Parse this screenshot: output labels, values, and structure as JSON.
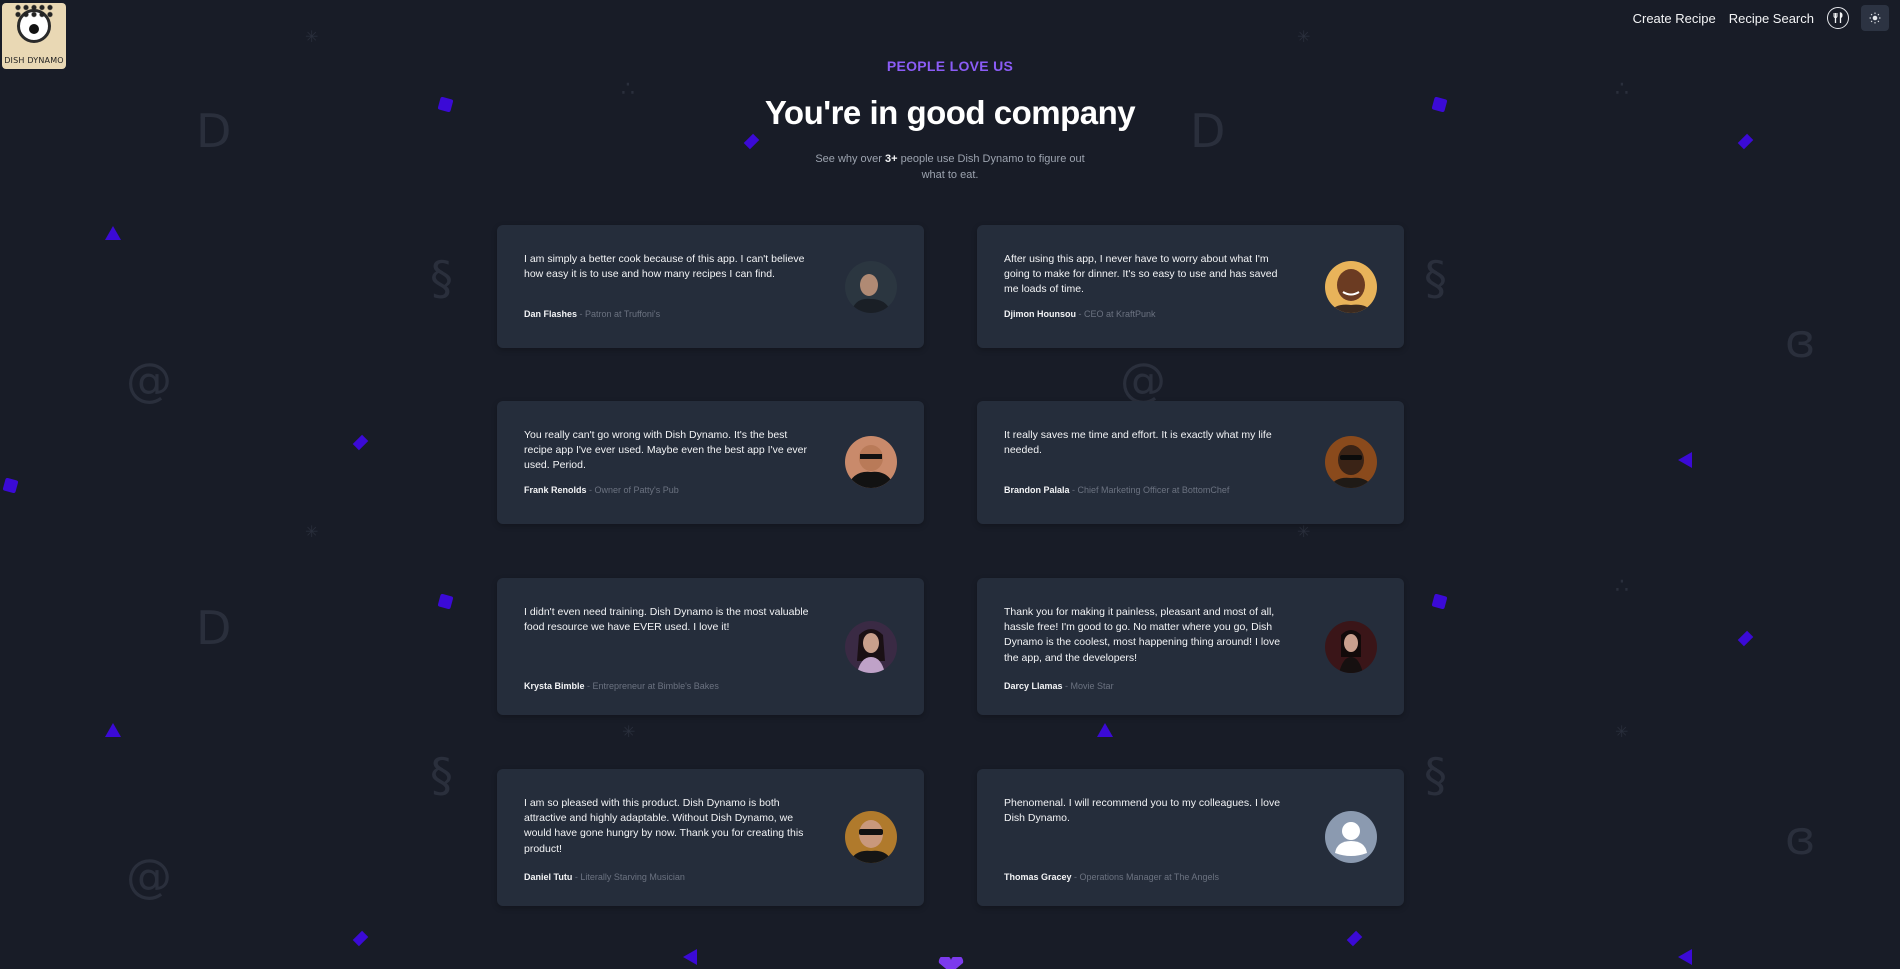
{
  "header": {
    "logo_text": "DISH DYNAMO",
    "nav": [
      "Create Recipe",
      "Recipe Search"
    ],
    "icons": [
      "utensils-icon",
      "sun-icon"
    ]
  },
  "hero": {
    "eyebrow": "PEOPLE LOVE US",
    "title": "You're in good company",
    "subtitle_pre": "See why over ",
    "subtitle_count": "3+",
    "subtitle_post": " people use Dish Dynamo to figure out what to eat."
  },
  "testimonials": [
    {
      "quote": "I am simply a better cook because of this app. I can't believe how easy it is to use and how many recipes I can find.",
      "name": "Dan Flashes",
      "role": "Patron at Truffoni's"
    },
    {
      "quote": "After using this app, I never have to worry about what I'm going to make for dinner. It's so easy to use and has saved me loads of time.",
      "name": "Djimon Hounsou",
      "role": "CEO at KraftPunk"
    },
    {
      "quote": "You really can't go wrong with Dish Dynamo. It's the best recipe app I've ever used. Maybe even the best app I've ever used. Period.",
      "name": "Frank Renolds",
      "role": "Owner of Patty's Pub"
    },
    {
      "quote": "It really saves me time and effort. It is exactly what my life needed.",
      "name": "Brandon Palala",
      "role": "Chief Marketing Officer at BottomChef"
    },
    {
      "quote": "I didn't even need training. Dish Dynamo is the most valuable food resource we have EVER used. I love it!",
      "name": "Krysta Bimble",
      "role": "Entrepreneur at Bimble's Bakes"
    },
    {
      "quote": "Thank you for making it painless, pleasant and most of all, hassle free! I'm good to go. No matter where you go, Dish Dynamo is the coolest, most happening thing around! I love the app, and the developers!",
      "name": "Darcy Llamas",
      "role": "Movie Star"
    },
    {
      "quote": "I am so pleased with this product. Dish Dynamo is both attractive and highly adaptable. Without Dish Dynamo, we would have gone hungry by now. Thank you for creating this product!",
      "name": "Daniel Tutu",
      "role": "Literally Starving Musician"
    },
    {
      "quote": "Phenomenal. I will recommend you to my colleagues. I love Dish Dynamo.",
      "name": "Thomas Gracey",
      "role": "Operations Manager at The Angels"
    }
  ],
  "colors": {
    "accent": "#8b5cf6",
    "card": "#252d3b",
    "background": "#181c27",
    "shape": "#3b0ad6"
  }
}
